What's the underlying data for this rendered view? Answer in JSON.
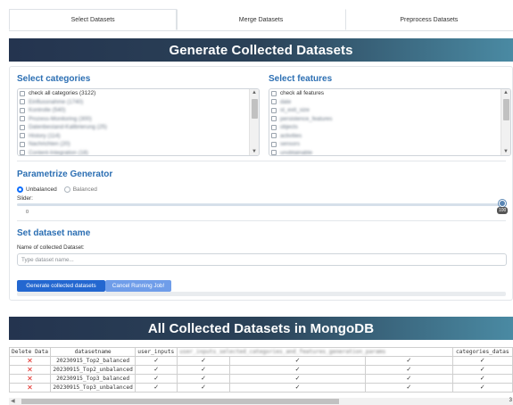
{
  "tabs": [
    {
      "label": "Select Datasets",
      "active": true
    },
    {
      "label": "Merge Datasets",
      "active": false
    },
    {
      "label": "Preprocess Datasets",
      "active": false
    }
  ],
  "header": {
    "title": "Generate Collected Datasets"
  },
  "categories": {
    "title": "Select categories",
    "check_all": "check all categories (3122)",
    "items": [
      "Einflussnahme (1740)",
      "Kontrolle (540)",
      "Prozess-Monitoring (300)",
      "Datenbestand-Kalibrierung (25)",
      "History (114)",
      "Nachrichten (20)",
      "Content-Integration (18)"
    ]
  },
  "features": {
    "title": "Select features",
    "check_all": "check all features",
    "items": [
      "date",
      "st_exit_size",
      "persistence_features",
      "objects",
      "activities",
      "sensors",
      "unobtainable"
    ]
  },
  "generator": {
    "title": "Parametrize Generator",
    "options": [
      "Unbalanced",
      "Balanced"
    ],
    "selected": "Unbalanced",
    "slider_label": "Slider:",
    "slider_min": "0",
    "slider_max": "100",
    "slider_value": 100
  },
  "dataset_name": {
    "title": "Set dataset name",
    "label": "Name of collected Dataset:",
    "placeholder": "Type dataset name..."
  },
  "actions": {
    "generate_label": "Generate collected datasets",
    "cancel_label": "Cancel Running Job!"
  },
  "collected": {
    "title": "All Collected Datasets in MongoDB",
    "columns": [
      "Delete Data",
      "datasetname",
      "user_inputs",
      "",
      "",
      "",
      "categories_datas"
    ],
    "blurred_header": "user_inputs_selected_categories_and_features_generation_params",
    "rows": [
      {
        "delete": "✕",
        "name": "20230915_Top2_balanced",
        "checks": [
          "✓",
          "✓",
          "✓",
          "✓",
          "✓"
        ]
      },
      {
        "delete": "✕",
        "name": "20230915_Top2_unbalanced",
        "checks": [
          "✓",
          "✓",
          "✓",
          "✓",
          "✓"
        ]
      },
      {
        "delete": "✕",
        "name": "20230915_Top3_balanced",
        "checks": [
          "✓",
          "✓",
          "✓",
          "✓",
          "✓"
        ]
      },
      {
        "delete": "✕",
        "name": "20230915_Top3_unbalanced",
        "checks": [
          "✓",
          "✓",
          "✓",
          "✓",
          "✓"
        ]
      }
    ],
    "scroll_number": "3"
  },
  "colors": {
    "accent": "#2c6fb3",
    "primary_button": "#2367d0",
    "secondary_button": "#6f9de9",
    "delete": "#e0201b"
  }
}
